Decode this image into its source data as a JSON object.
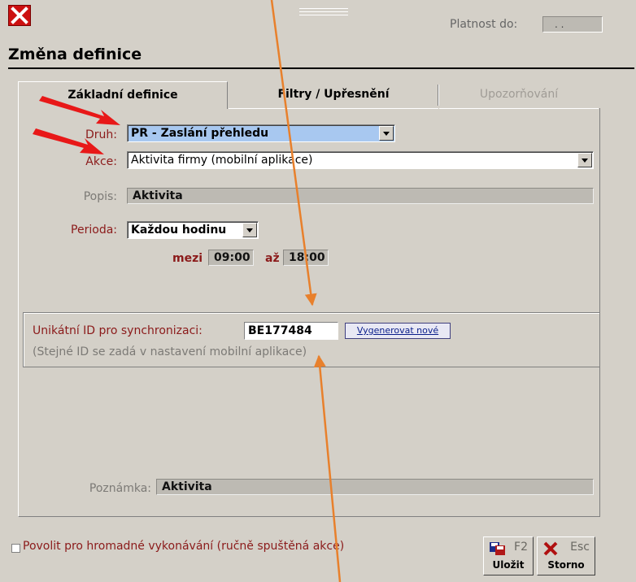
{
  "header": {
    "platnost_label": "Platnost do:",
    "platnost_value": ". .",
    "title": "Změna definice"
  },
  "tabs": [
    {
      "label": "Základní definice",
      "state": "active"
    },
    {
      "label": "Filtry / Upřesnění",
      "state": "normal"
    },
    {
      "label": "Upozorňování",
      "state": "disabled"
    }
  ],
  "form": {
    "druh_label": "Druh:",
    "druh_value": "PR - Zaslání přehledu",
    "akce_label": "Akce:",
    "akce_value": "Aktivita firmy (mobilní aplikace)",
    "popis_label": "Popis:",
    "popis_value": "Aktivita",
    "perioda_label": "Perioda:",
    "perioda_value": "Každou hodinu",
    "mezi_label": "mezi",
    "mezi_value": "09:00",
    "az_label": "až",
    "az_value": "18:00"
  },
  "sync": {
    "label": "Unikátní ID pro synchronizaci:",
    "id_value": "BE177484",
    "generate_button": "Vygenerovat nové",
    "note": "(Stejné ID se zadá v nastavení mobilní aplikace)"
  },
  "poznamka": {
    "label": "Poznámka:",
    "value": "Aktivita"
  },
  "footer": {
    "checkbox_label": "Povolit pro hromadné vykonávání (ručně spuštěná akce)",
    "checkbox_checked": false,
    "save_key": "F2",
    "save_label": "Uložit",
    "cancel_key": "Esc",
    "cancel_label": "Storno"
  },
  "colors": {
    "window_bg": "#d4d0c8",
    "label_red": "#8b1a1a",
    "selected_bg": "#a8c8f0",
    "annotation_red": "#e81818",
    "annotation_orange": "#e8802c"
  }
}
